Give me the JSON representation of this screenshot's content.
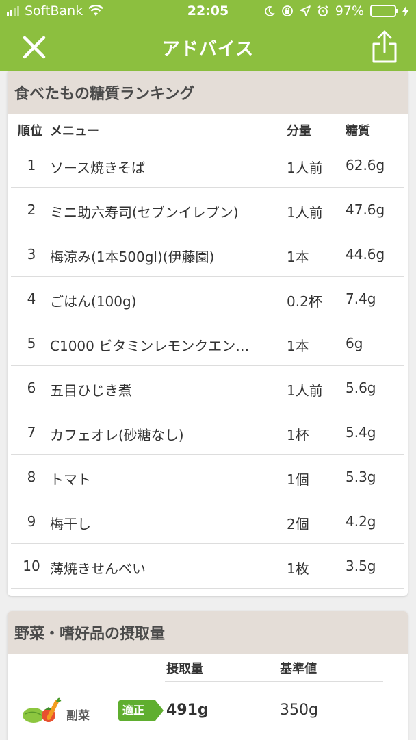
{
  "status": {
    "carrier": "SoftBank",
    "time": "22:05",
    "battery": "97%"
  },
  "nav": {
    "title": "アドバイス",
    "close_icon": "close-icon",
    "share_icon": "share-icon"
  },
  "ranking": {
    "title": "食べたもの糖質ランキング",
    "headers": {
      "rank": "順位",
      "menu": "メニュー",
      "amount": "分量",
      "sugar": "糖質"
    },
    "rows": [
      {
        "rank": "1",
        "name": "ソース焼きそば",
        "amount": "1人前",
        "sugar": "62.6g"
      },
      {
        "rank": "2",
        "name": "ミニ助六寿司(セブンイレブン)",
        "amount": "1人前",
        "sugar": "47.6g"
      },
      {
        "rank": "3",
        "name": "梅涼み(1本500gl)(伊藤園)",
        "amount": "1本",
        "sugar": "44.6g"
      },
      {
        "rank": "4",
        "name": "ごはん(100g)",
        "amount": "0.2杯",
        "sugar": "7.4g"
      },
      {
        "rank": "5",
        "name": "C1000 ビタミンレモンクエン…",
        "amount": "1本",
        "sugar": "6g"
      },
      {
        "rank": "6",
        "name": "五目ひじき煮",
        "amount": "1人前",
        "sugar": "5.6g"
      },
      {
        "rank": "7",
        "name": "カフェオレ(砂糖なし)",
        "amount": "1杯",
        "sugar": "5.4g"
      },
      {
        "rank": "8",
        "name": "トマト",
        "amount": "1個",
        "sugar": "5.3g"
      },
      {
        "rank": "9",
        "name": "梅干し",
        "amount": "2個",
        "sugar": "4.2g"
      },
      {
        "rank": "10",
        "name": "薄焼きせんべい",
        "amount": "1枚",
        "sugar": "3.5g"
      }
    ]
  },
  "intake": {
    "title": "野菜・嗜好品の摂取量",
    "headers": {
      "amount": "摂取量",
      "standard": "基準値"
    },
    "rows": [
      {
        "label": "副菜",
        "badge": "適正",
        "amount": "491g",
        "standard": "350g",
        "icon": "vegetables-icon"
      }
    ]
  },
  "colors": {
    "brand_green": "#8cbf3f",
    "badge_green": "#5fae2f",
    "section_header": "#e4ddd7",
    "battery_yellow": "#f2c200"
  }
}
